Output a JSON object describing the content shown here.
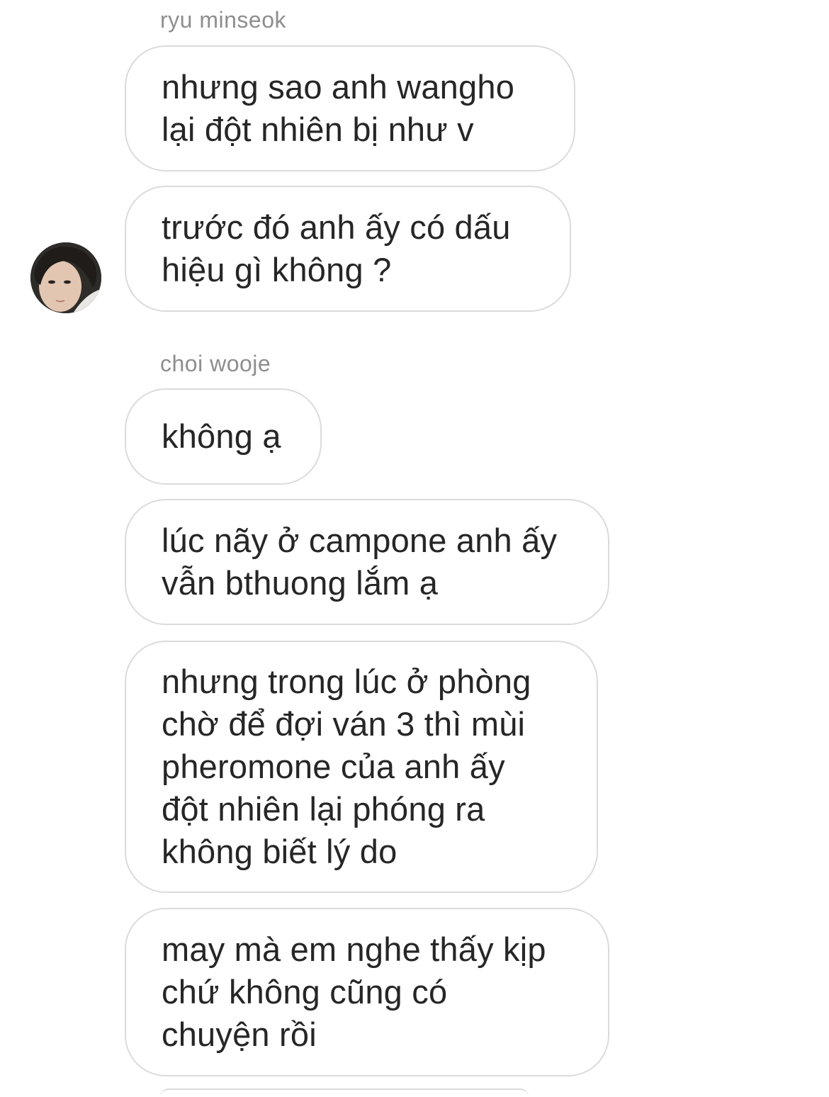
{
  "conversation": {
    "groups": [
      {
        "sender": "ryu minseok",
        "messages": [
          "nhưng sao anh wangho\nlại đột nhiên bị như v",
          "trước đó anh ấy có dấu\nhiệu gì không ?"
        ]
      },
      {
        "sender": "choi wooje",
        "messages": [
          "không ạ",
          "lúc nãy ở campone anh ấy\nvẫn bthuong lắm ạ",
          "nhưng trong lúc ở phòng\nchờ để đợi ván 3 thì mùi\npheromone của anh ấy\nđột nhiên lại phóng ra\nkhông biết lý do",
          "may mà em nghe thấy kịp\nchứ không cũng có\nchuyện rồi"
        ]
      }
    ]
  },
  "colors": {
    "bubble_border": "#dbdbdb",
    "text": "#262626",
    "sender_name": "#8e8e8e",
    "background": "#ffffff"
  },
  "icons": {
    "avatar": "profile-photo-avatar"
  }
}
